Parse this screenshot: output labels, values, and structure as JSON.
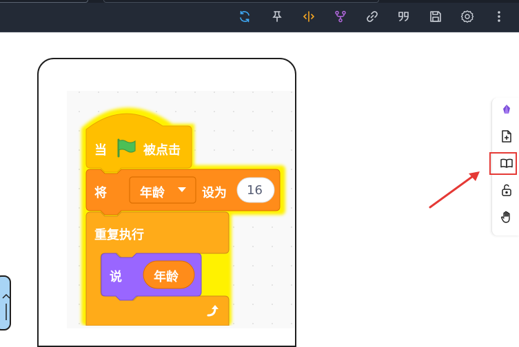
{
  "toolbar": {
    "icons": [
      {
        "name": "sync-icon",
        "color": "#3fa9f5"
      },
      {
        "name": "pin-icon",
        "color": "#c9ced6"
      },
      {
        "name": "split-code-icon",
        "color": "#f5a623"
      },
      {
        "name": "branch-icon",
        "color": "#b468e0"
      },
      {
        "name": "link-icon",
        "color": "#c9ced6"
      },
      {
        "name": "quote-icon",
        "color": "#c9ced6"
      },
      {
        "name": "save-icon",
        "color": "#c9ced6"
      },
      {
        "name": "settings-icon",
        "color": "#c9ced6"
      },
      {
        "name": "more-vertical-icon",
        "color": "#c9ced6"
      }
    ]
  },
  "scratch": {
    "hat_label_1": "当",
    "hat_label_2": "被点击",
    "set_label_1": "将",
    "set_variable": "年龄",
    "set_label_2": "设为",
    "set_value": "16",
    "forever_label": "重复执行",
    "say_label": "说",
    "say_variable": "年龄"
  },
  "side_tools": [
    {
      "name": "crystal-icon"
    },
    {
      "name": "file-plus-icon"
    },
    {
      "name": "book-icon"
    },
    {
      "name": "unlock-icon"
    },
    {
      "name": "hand-icon"
    }
  ],
  "colors": {
    "hat_block": "#ffbf00",
    "set_block": "#ff8c1a",
    "control_block": "#ffab19",
    "looks_block": "#9966ff",
    "glow": "#fff200",
    "annotation_red": "#e53935"
  }
}
